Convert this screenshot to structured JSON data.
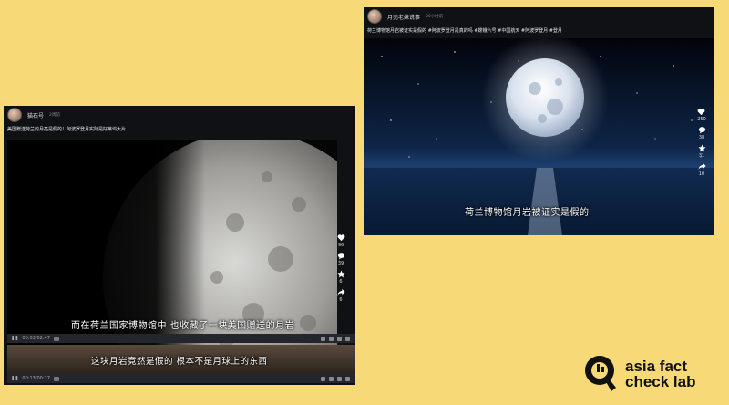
{
  "left_post": {
    "account_name": "猫石号",
    "time": "2周前",
    "caption": "美国赠送荷兰的月亮是假的！阿波罗登月实际是好莱坞大片",
    "subtitle_1": "而在荷兰国家博物馆中 也收藏了一块美国赠送的月岩",
    "subtitle_2": "这块月岩竟然是假的 根本不是月球上的东西",
    "time_1": "00:03/02:47",
    "time_2": "00:13/00:27",
    "actions": [
      {
        "icon": "heart-icon",
        "count": "96"
      },
      {
        "icon": "comment-icon",
        "count": "39"
      },
      {
        "icon": "star-icon",
        "count": "6"
      },
      {
        "icon": "share-icon",
        "count": "6"
      }
    ]
  },
  "right_post": {
    "account_name": "月亮老妹说事",
    "time": "20小时前",
    "caption": "荷兰博物馆月岩被证实是假的 #阿波罗登月是真的吗 #嫦娥六号 #中国航天 #阿波罗登月 #登月",
    "subtitle": "荷兰博物馆月岩被证实是假的",
    "actions": [
      {
        "icon": "heart-icon",
        "count": "250"
      },
      {
        "icon": "comment-icon",
        "count": "38"
      },
      {
        "icon": "star-icon",
        "count": "31"
      },
      {
        "icon": "share-icon",
        "count": "10"
      }
    ]
  },
  "logo": {
    "line1": "asia fact",
    "line2": "check lab"
  }
}
